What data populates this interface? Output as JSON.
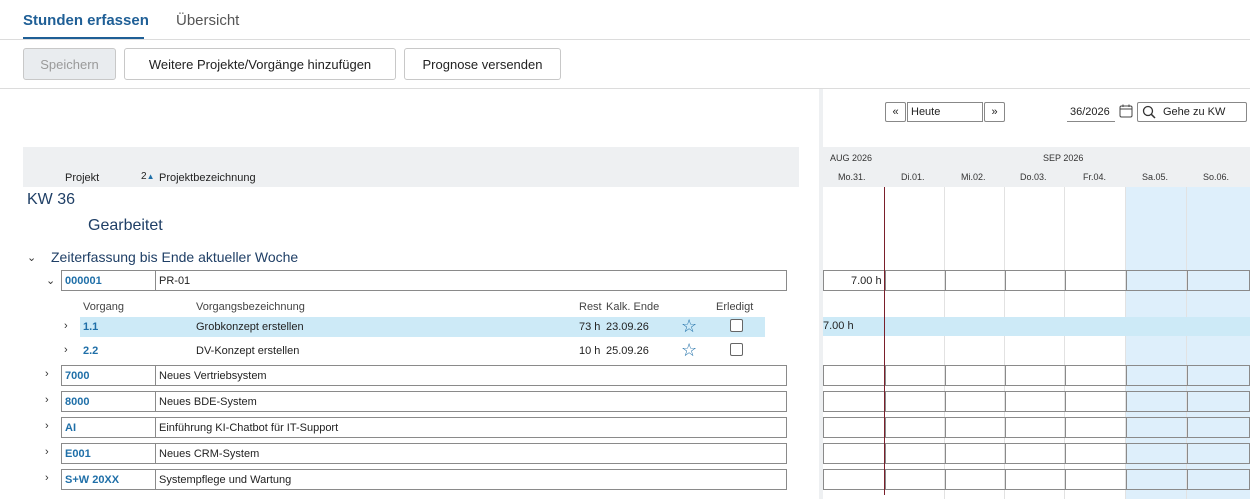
{
  "tabs": {
    "active": "Stunden erfassen",
    "inactive": "Übersicht"
  },
  "toolbar": {
    "save": "Speichern",
    "add_projects": "Weitere Projekte/Vorgänge hinzufügen",
    "send_forecast": "Prognose versenden"
  },
  "table_header": {
    "projekt": "Projekt",
    "sort": "2",
    "projektbezeichnung": "Projektbezeichnung"
  },
  "kw_label": "KW 36",
  "gearbeitet": "Gearbeitet",
  "section_title": "Zeiterfassung bis Ende aktueller Woche",
  "subheader": {
    "vorgang": "Vorgang",
    "vorgangsbezeichnung": "Vorgangsbezeichnung",
    "rest": "Rest",
    "kalk_ende": "Kalk. Ende",
    "erledigt": "Erledigt"
  },
  "projects": [
    {
      "code": "000001",
      "name": "PR-01",
      "hours": "7.00 h"
    },
    {
      "code": "7000",
      "name": "Neues Vertriebsystem"
    },
    {
      "code": "8000",
      "name": "Neues BDE-System"
    },
    {
      "code": "AI",
      "name": "Einführung KI-Chatbot für IT-Support"
    },
    {
      "code": "E001",
      "name": "Neues CRM-System"
    },
    {
      "code": "S+W 20XX",
      "name": "Systempflege und Wartung"
    }
  ],
  "vorgaenge": [
    {
      "code": "1.1",
      "name": "Grobkonzept erstellen",
      "rest": "73 h",
      "ende": "23.09.26",
      "hours": "7.00 h"
    },
    {
      "code": "2.2",
      "name": "DV-Konzept erstellen",
      "rest": "10 h",
      "ende": "25.09.26"
    }
  ],
  "nav": {
    "prev": "«",
    "today": "Heute",
    "next": "»",
    "week": "36/2026",
    "goto": "Gehe zu KW"
  },
  "calendar": {
    "month1": "AUG 2026",
    "month2": "SEP 2026",
    "days": [
      "Mo.31.",
      "Di.01.",
      "Mi.02.",
      "Do.03.",
      "Fr.04.",
      "Sa.05.",
      "So.06."
    ]
  },
  "colors": {
    "accent": "#1f5f96",
    "link": "#1f6fa8",
    "highlight": "#cdeaf7",
    "weekend": "#deeffb",
    "today_line": "#7a1f2b"
  },
  "icons": {
    "calendar": "calendar-icon",
    "search": "search-icon",
    "star": "star-icon"
  }
}
